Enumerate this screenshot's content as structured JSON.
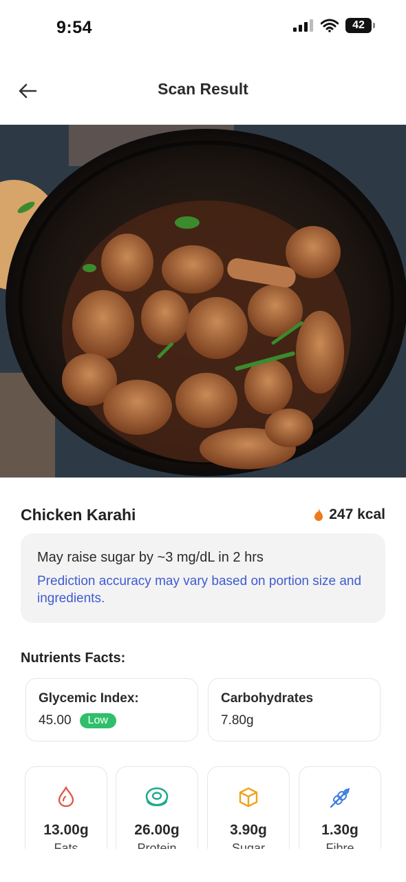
{
  "status": {
    "time": "9:54",
    "battery": "42"
  },
  "header": {
    "title": "Scan Result"
  },
  "food": {
    "name": "Chicken Karahi",
    "calories": "247 kcal"
  },
  "prediction": {
    "main": "May raise sugar by ~3 mg/dL in 2 hrs",
    "note": "Prediction accuracy may vary based on portion size and ingredients."
  },
  "nutrients": {
    "title": "Nutrients Facts:",
    "glycemic": {
      "label": "Glycemic Index:",
      "value": "45.00",
      "badge": "Low"
    },
    "carbs": {
      "label": "Carbohydrates",
      "value": "7.80g"
    },
    "macros": [
      {
        "icon": "droplet-icon",
        "value": "13.00g",
        "label": "Fats",
        "color": "#e05a4a"
      },
      {
        "icon": "meat-icon",
        "value": "26.00g",
        "label": "Protein",
        "color": "#1fa98c"
      },
      {
        "icon": "cube-icon",
        "value": "3.90g",
        "label": "Sugar",
        "color": "#f0a21a"
      },
      {
        "icon": "wheat-icon",
        "value": "1.30g",
        "label": "Fibre",
        "color": "#3f7fe0"
      }
    ]
  },
  "colors": {
    "accent_blue": "#3f5bd0",
    "low_badge": "#2fbf6a",
    "flame": "#f07a1a"
  }
}
